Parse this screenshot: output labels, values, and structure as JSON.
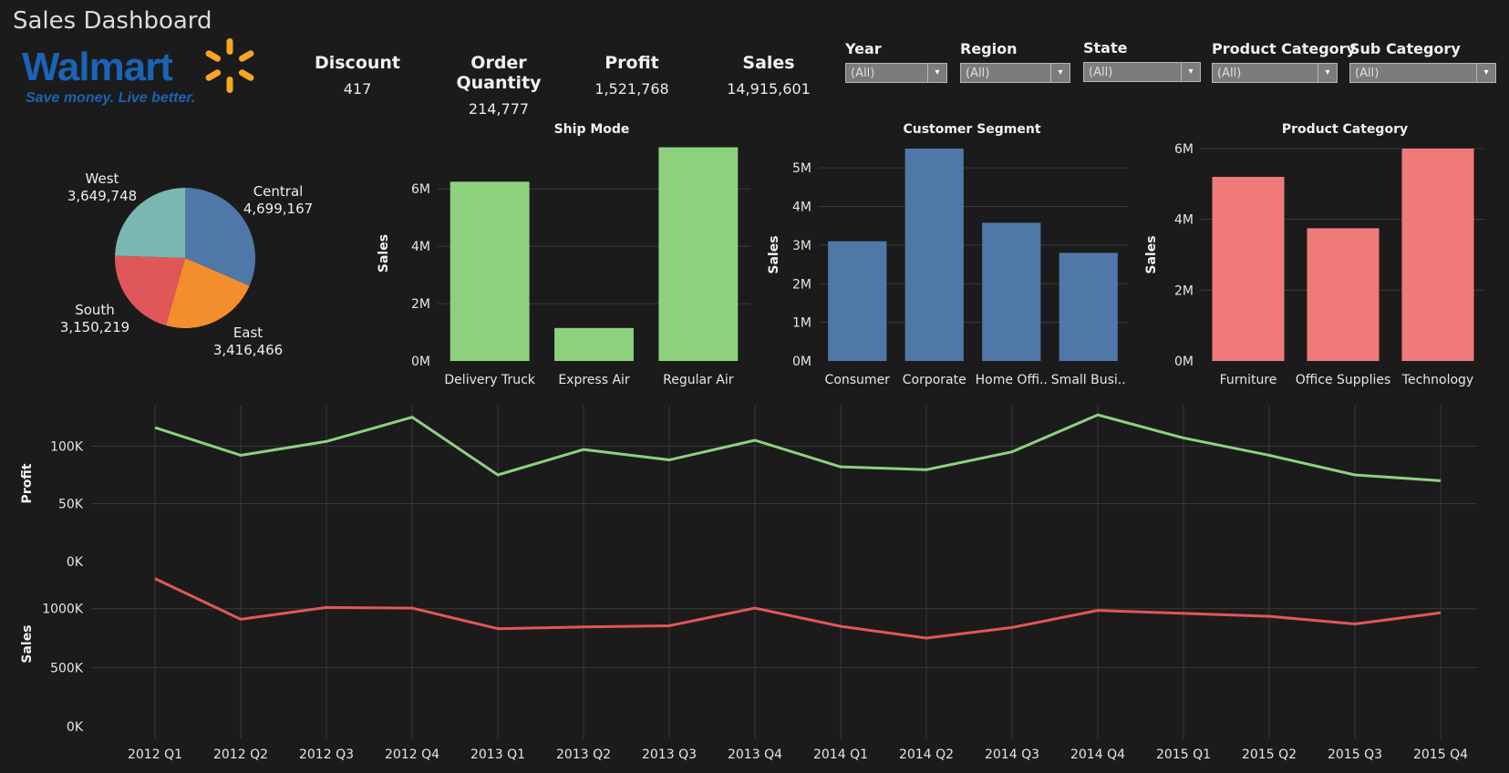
{
  "header": {
    "title": "Sales Dashboard",
    "logo": {
      "brand": "Walmart",
      "tagline": "Save money. Live better."
    }
  },
  "kpis": [
    {
      "label": "Discount",
      "value": "417"
    },
    {
      "label": "Order Quantity",
      "value": "214,777"
    },
    {
      "label": "Profit",
      "value": "1,521,768"
    },
    {
      "label": "Sales",
      "value": "14,915,601"
    }
  ],
  "filters": [
    {
      "label": "Year",
      "value": "(All)"
    },
    {
      "label": "Region",
      "value": "(All)"
    },
    {
      "label": "State",
      "value": "(All)"
    },
    {
      "label": "Product Category",
      "value": "(All)"
    },
    {
      "label": "Sub Category",
      "value": "(All)"
    }
  ],
  "colors": {
    "background": "#1b1b1b",
    "green": "#8dd17f",
    "blue": "#4f78a8",
    "red": "#f07a7a",
    "pie": {
      "West": "#7ab7b3",
      "Central": "#4f78a8",
      "East": "#f28e2c",
      "South": "#e05759"
    },
    "profit_line": "#8dd17f",
    "sales_line": "#e05759",
    "logo_blue": "#1a63b5",
    "logo_yellow": "#f6a623"
  },
  "chart_data": [
    {
      "id": "region-pie",
      "type": "pie",
      "title": "",
      "slices": [
        {
          "label": "Central",
          "value": 4699167,
          "display": "4,699,167"
        },
        {
          "label": "East",
          "value": 3416466,
          "display": "3,416,466"
        },
        {
          "label": "South",
          "value": 3150219,
          "display": "3,150,219"
        },
        {
          "label": "West",
          "value": 3649748,
          "display": "3,649,748"
        }
      ]
    },
    {
      "id": "ship-mode",
      "type": "bar",
      "title": "Ship Mode",
      "ylabel": "Sales",
      "categories": [
        "Delivery Truck",
        "Express Air",
        "Regular Air"
      ],
      "values": [
        6250000,
        1150000,
        7450000
      ],
      "yticks": [
        {
          "v": 0,
          "label": "0M"
        },
        {
          "v": 2000000,
          "label": "2M"
        },
        {
          "v": 4000000,
          "label": "4M"
        },
        {
          "v": 6000000,
          "label": "6M"
        }
      ],
      "ylim": [
        0,
        7500000
      ],
      "color": "#8dd17f"
    },
    {
      "id": "customer-segment",
      "type": "bar",
      "title": "Customer Segment",
      "ylabel": "Sales",
      "categories": [
        "Consumer",
        "Corporate",
        "Home Offi..",
        "Small Busi.."
      ],
      "values": [
        3100000,
        5500000,
        3580000,
        2800000
      ],
      "yticks": [
        {
          "v": 0,
          "label": "0M"
        },
        {
          "v": 1000000,
          "label": "1M"
        },
        {
          "v": 2000000,
          "label": "2M"
        },
        {
          "v": 3000000,
          "label": "3M"
        },
        {
          "v": 4000000,
          "label": "4M"
        },
        {
          "v": 5000000,
          "label": "5M"
        }
      ],
      "ylim": [
        0,
        5500000
      ],
      "color": "#4f78a8"
    },
    {
      "id": "product-category",
      "type": "bar",
      "title": "Product Category",
      "ylabel": "Sales",
      "categories": [
        "Furniture",
        "Office Supplies",
        "Technology"
      ],
      "values": [
        5200000,
        3750000,
        6000000
      ],
      "yticks": [
        {
          "v": 0,
          "label": "0M"
        },
        {
          "v": 2000000,
          "label": "2M"
        },
        {
          "v": 4000000,
          "label": "4M"
        },
        {
          "v": 6000000,
          "label": "6M"
        }
      ],
      "ylim": [
        0,
        6000000
      ],
      "color": "#f07a7a"
    },
    {
      "id": "quarterly-trend",
      "type": "line",
      "title": "",
      "x": [
        "2012 Q1",
        "2012 Q2",
        "2012 Q3",
        "2012 Q4",
        "2013 Q1",
        "2013 Q2",
        "2013 Q3",
        "2013 Q4",
        "2014 Q1",
        "2014 Q2",
        "2014 Q3",
        "2014 Q4",
        "2015 Q1",
        "2015 Q2",
        "2015 Q3",
        "2015 Q4"
      ],
      "panels": [
        {
          "ylabel": "Profit",
          "series": [
            {
              "values": [
                116000,
                92000,
                104000,
                125000,
                75000,
                97000,
                88000,
                105000,
                82000,
                79500,
                95000,
                127000,
                107000,
                92000,
                75000,
                70000
              ]
            }
          ],
          "yticks": [
            {
              "v": 0,
              "label": "0K"
            },
            {
              "v": 50000,
              "label": "50K"
            },
            {
              "v": 100000,
              "label": "100K"
            }
          ],
          "ylim": [
            0,
            135000
          ],
          "color": "#8dd17f"
        },
        {
          "ylabel": "Sales",
          "series": [
            {
              "values": [
                1255000,
                910000,
                1010000,
                1005000,
                830000,
                845000,
                855000,
                1005000,
                850000,
                750000,
                840000,
                985000,
                960000,
                935000,
                870000,
                965000
              ]
            }
          ],
          "yticks": [
            {
              "v": 0,
              "label": "0K"
            },
            {
              "v": 500000,
              "label": "500K"
            },
            {
              "v": 1000000,
              "label": "1000K"
            }
          ],
          "ylim": [
            0,
            1400000
          ],
          "color": "#e05759"
        }
      ]
    }
  ]
}
